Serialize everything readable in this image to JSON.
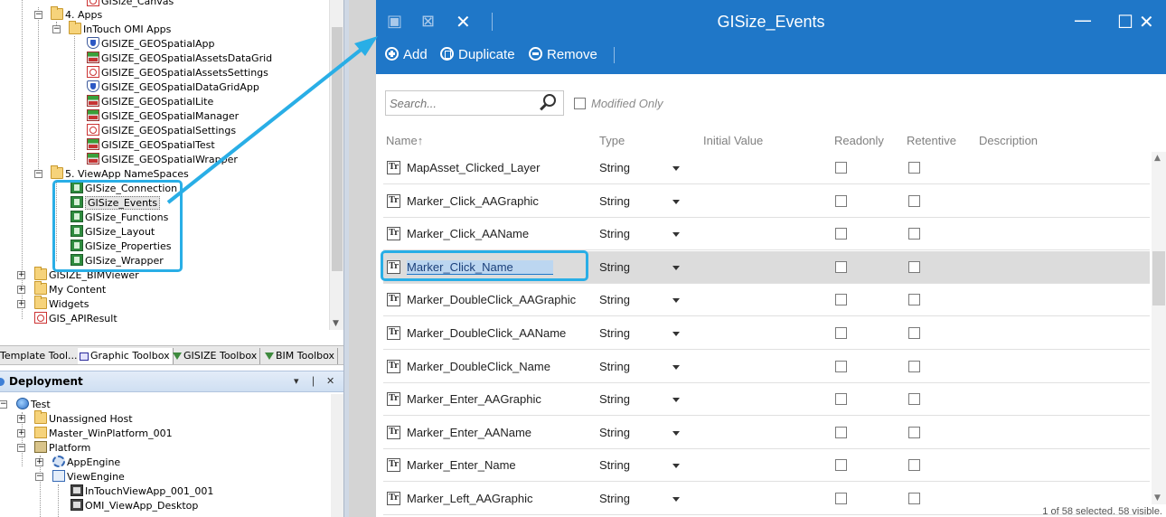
{
  "tree_top": {
    "items": [
      {
        "label": "GISize_Canvas",
        "icon": "script-icon"
      },
      {
        "label": "4. Apps",
        "icon": "folder-icon"
      },
      {
        "label": "InTouch OMI Apps",
        "icon": "folder-icon"
      },
      {
        "label": "GISIZE_GEOSpatialApp",
        "icon": "shield-icon"
      },
      {
        "label": "GISIZE_GEOSpatialAssetsDataGrid",
        "icon": "grid-icon"
      },
      {
        "label": "GISIZE_GEOSpatialAssetsSettings",
        "icon": "script-icon"
      },
      {
        "label": "GISIZE_GEOSpatialDataGridApp",
        "icon": "shield-icon"
      },
      {
        "label": "GISIZE_GEOSpatialLite",
        "icon": "grid-icon"
      },
      {
        "label": "GISIZE_GEOSpatialManager",
        "icon": "grid-icon"
      },
      {
        "label": "GISIZE_GEOSpatialSettings",
        "icon": "script-icon"
      },
      {
        "label": "GISIZE_GEOSpatialTest",
        "icon": "grid-icon"
      },
      {
        "label": "GISIZE_GEOSpatialWrapper",
        "icon": "grid-icon"
      },
      {
        "label": "5. ViewApp NameSpaces",
        "icon": "folder-icon"
      },
      {
        "label": "GISize_Connection",
        "icon": "namespace-icon"
      },
      {
        "label": "GISize_Events",
        "icon": "namespace-icon"
      },
      {
        "label": "GISize_Functions",
        "icon": "namespace-icon"
      },
      {
        "label": "GISize_Layout",
        "icon": "namespace-icon"
      },
      {
        "label": "GISize_Properties",
        "icon": "namespace-icon"
      },
      {
        "label": "GISize_Wrapper",
        "icon": "namespace-icon"
      },
      {
        "label": "GISIZE_BIMViewer",
        "icon": "folder-icon"
      },
      {
        "label": "My Content",
        "icon": "folder-icon"
      },
      {
        "label": "Widgets",
        "icon": "folder-icon"
      },
      {
        "label": "GIS_APIResult",
        "icon": "script-icon"
      }
    ]
  },
  "toolbox_tabs": [
    "Template Tool...",
    "Graphic Toolbox",
    "GISIZE Toolbox",
    "BIM Toolbox"
  ],
  "deployment": {
    "title": "Deployment",
    "pin": "❘",
    "close": "✕",
    "menu": "▾",
    "items": [
      {
        "label": "Test",
        "icon": "galaxy-icon"
      },
      {
        "label": "Unassigned Host",
        "icon": "folder-icon"
      },
      {
        "label": "Master_WinPlatform_001",
        "icon": "host-icon"
      },
      {
        "label": "Platform",
        "icon": "platform-icon"
      },
      {
        "label": "AppEngine",
        "icon": "engine-icon"
      },
      {
        "label": "ViewEngine",
        "icon": "view-engine-icon"
      },
      {
        "label": "InTouchViewApp_001_001",
        "icon": "app-icon"
      },
      {
        "label": "OMI_ViewApp_Desktop",
        "icon": "app-icon"
      }
    ]
  },
  "dialog": {
    "title": "GISize_Events",
    "commands": {
      "add": "Add",
      "duplicate": "Duplicate",
      "remove": "Remove"
    },
    "search_placeholder": "Search...",
    "modified_only": "Modified Only",
    "columns": {
      "name": "Name",
      "type": "Type",
      "initial_value": "Initial Value",
      "readonly": "Readonly",
      "retentive": "Retentive",
      "description": "Description"
    },
    "sort_arrow": "↑",
    "rows": [
      {
        "name": "MapAsset_Clicked_Layer",
        "type": "String",
        "readonly": false,
        "retentive": false
      },
      {
        "name": "Marker_Click_AAGraphic",
        "type": "String",
        "readonly": false,
        "retentive": false
      },
      {
        "name": "Marker_Click_AAName",
        "type": "String",
        "readonly": false,
        "retentive": false
      },
      {
        "name": "Marker_Click_Name",
        "type": "String",
        "readonly": false,
        "retentive": false,
        "selected": true
      },
      {
        "name": "Marker_DoubleClick_AAGraphic",
        "type": "String",
        "readonly": false,
        "retentive": false
      },
      {
        "name": "Marker_DoubleClick_AAName",
        "type": "String",
        "readonly": false,
        "retentive": false
      },
      {
        "name": "Marker_DoubleClick_Name",
        "type": "String",
        "readonly": false,
        "retentive": false
      },
      {
        "name": "Marker_Enter_AAGraphic",
        "type": "String",
        "readonly": false,
        "retentive": false
      },
      {
        "name": "Marker_Enter_AAName",
        "type": "String",
        "readonly": false,
        "retentive": false
      },
      {
        "name": "Marker_Enter_Name",
        "type": "String",
        "readonly": false,
        "retentive": false
      },
      {
        "name": "Marker_Left_AAGraphic",
        "type": "String",
        "readonly": false,
        "retentive": false
      }
    ],
    "status": "1 of 58 selected. 58 visible.",
    "type_glyph": "Tr"
  },
  "colors": {
    "accent": "#1f77c8",
    "highlight": "#29aee6"
  }
}
